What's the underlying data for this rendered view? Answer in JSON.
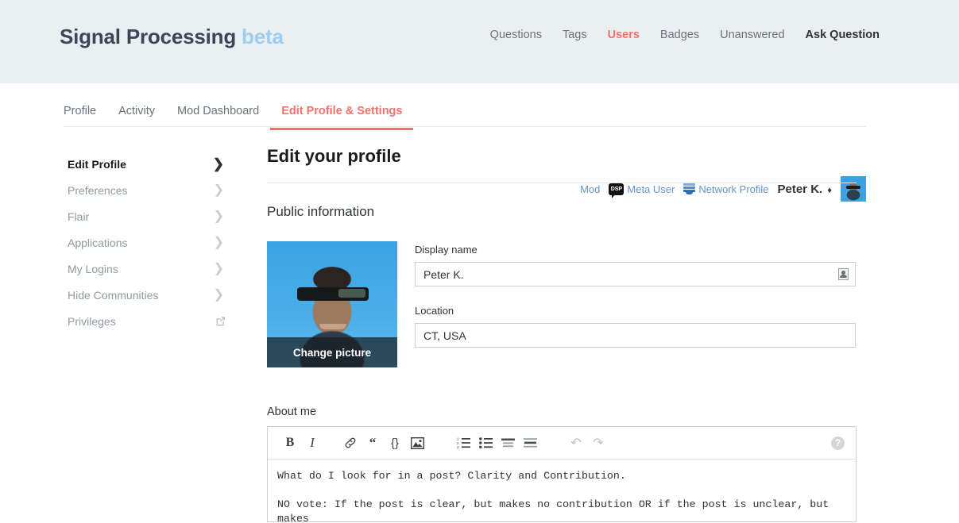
{
  "header": {
    "site_title": "Signal Processing",
    "site_title_beta": "beta",
    "nav": [
      {
        "label": "Questions",
        "state": "normal"
      },
      {
        "label": "Tags",
        "state": "normal"
      },
      {
        "label": "Users",
        "state": "active"
      },
      {
        "label": "Badges",
        "state": "normal"
      },
      {
        "label": "Unanswered",
        "state": "normal"
      },
      {
        "label": "Ask Question",
        "state": "ask"
      }
    ],
    "accent_color": "#f4706b",
    "background_color": "#eaeff2",
    "title_color": "#3b4758",
    "beta_color": "#9ecdf0"
  },
  "subnav": {
    "tabs": [
      {
        "label": "Profile",
        "active": false
      },
      {
        "label": "Activity",
        "active": false
      },
      {
        "label": "Mod Dashboard",
        "active": false
      },
      {
        "label": "Edit Profile & Settings",
        "active": true
      }
    ]
  },
  "userbar": {
    "mod_link": "Mod",
    "dsp_badge": "DSP",
    "meta_user": "Meta User",
    "network_profile": "Network Profile",
    "username": "Peter K.",
    "mod_diamond": "♦"
  },
  "sidebar": {
    "items": [
      {
        "label": "Edit Profile",
        "active": true,
        "icon": "chevron-right-icon"
      },
      {
        "label": "Preferences",
        "active": false,
        "icon": "chevron-right-icon"
      },
      {
        "label": "Flair",
        "active": false,
        "icon": "chevron-right-icon"
      },
      {
        "label": "Applications",
        "active": false,
        "icon": "chevron-right-icon"
      },
      {
        "label": "My Logins",
        "active": false,
        "icon": "chevron-right-icon"
      },
      {
        "label": "Hide Communities",
        "active": false,
        "icon": "chevron-right-icon"
      },
      {
        "label": "Privileges",
        "active": false,
        "icon": "external-link-icon"
      }
    ],
    "chevron_glyph": "❯"
  },
  "main": {
    "page_title": "Edit your profile",
    "section_title": "Public information",
    "photo": {
      "change_picture_label": "Change picture"
    },
    "display_name": {
      "label": "Display name",
      "value": "Peter K.",
      "placeholder": ""
    },
    "location": {
      "label": "Location",
      "value": "CT, USA",
      "placeholder": ""
    },
    "about_me": {
      "label": "About me",
      "text": "What do I look for in a post? Clarity and Contribution.\n\nNO vote: If the post is clear, but makes no contribution OR if the post is unclear, but makes\na contribution (though I will try to improve the clarity either by comments or direct edit)",
      "toolbar": [
        {
          "name": "bold-icon",
          "label": "B"
        },
        {
          "name": "italic-icon",
          "label": "I"
        },
        {
          "name": "link-icon",
          "label": ""
        },
        {
          "name": "quote-icon",
          "label": "“"
        },
        {
          "name": "code-icon",
          "label": "{}"
        },
        {
          "name": "image-icon",
          "label": ""
        },
        {
          "name": "ordered-list-icon",
          "label": ""
        },
        {
          "name": "bullet-list-icon",
          "label": ""
        },
        {
          "name": "heading-icon",
          "label": ""
        },
        {
          "name": "horizontal-rule-icon",
          "label": ""
        },
        {
          "name": "undo-icon",
          "label": "↶"
        },
        {
          "name": "redo-icon",
          "label": "↷"
        }
      ],
      "help_label": "?"
    }
  }
}
